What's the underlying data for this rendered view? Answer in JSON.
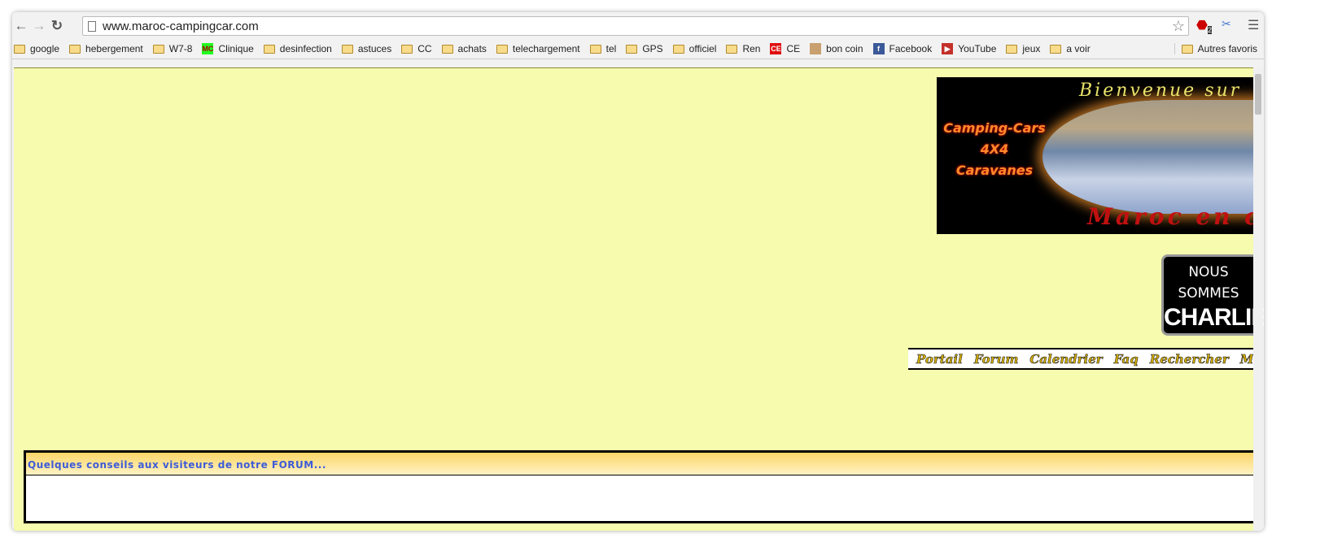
{
  "browser": {
    "url": "www.maroc-campingcar.com",
    "adblock_badge": "2",
    "bookmarks": [
      {
        "label": "google",
        "icon": "folder-icon"
      },
      {
        "label": "hebergement",
        "icon": "folder-icon"
      },
      {
        "label": "W7-8",
        "icon": "folder-icon"
      },
      {
        "label": "Clinique",
        "icon": "mcc-favicon"
      },
      {
        "label": "desinfection",
        "icon": "folder-icon"
      },
      {
        "label": "astuces",
        "icon": "folder-icon"
      },
      {
        "label": "CC",
        "icon": "folder-icon"
      },
      {
        "label": "achats",
        "icon": "folder-icon"
      },
      {
        "label": "telechargement",
        "icon": "folder-icon"
      },
      {
        "label": "tel",
        "icon": "folder-icon"
      },
      {
        "label": "GPS",
        "icon": "folder-icon"
      },
      {
        "label": "officiel",
        "icon": "folder-icon"
      },
      {
        "label": "Ren",
        "icon": "folder-icon"
      },
      {
        "label": "CE",
        "icon": "ce-favicon"
      },
      {
        "label": "bon coin",
        "icon": "box-favicon"
      },
      {
        "label": "Facebook",
        "icon": "facebook-icon"
      },
      {
        "label": "YouTube",
        "icon": "youtube-icon"
      },
      {
        "label": "jeux",
        "icon": "folder-icon"
      },
      {
        "label": "a voir",
        "icon": "folder-icon"
      }
    ],
    "other_bookmarks": "Autres favoris"
  },
  "page": {
    "banner": {
      "welcome": "Bienvenue sur",
      "line1": "Camping-Cars",
      "line2": "4X4",
      "line3": "Caravanes",
      "footer": "Maroc en c"
    },
    "charlie": {
      "line1": "NOUS",
      "line2": "SOMMES",
      "line3": "CHARLIE"
    },
    "menu": [
      "Portail",
      "Forum",
      "Calendrier",
      "Faq",
      "Rechercher",
      "Membres"
    ],
    "forum_box": {
      "title": "Quelques conseils aux visiteurs de notre FORUM..."
    }
  },
  "colors": {
    "page_bg": "#f6fbae",
    "menu_text": "#d7b000",
    "box_title": "#3d5bd8"
  }
}
